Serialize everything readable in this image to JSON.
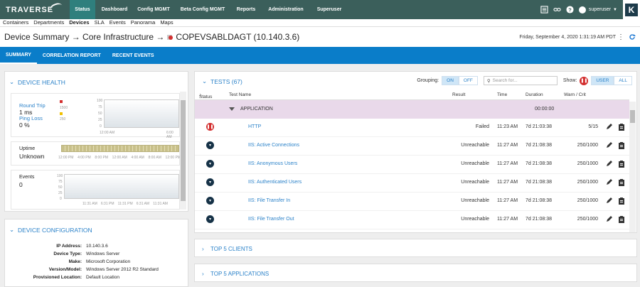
{
  "brand": {
    "logo_text": "TRAVERSE"
  },
  "topnav": [
    {
      "label": "Status",
      "active": true
    },
    {
      "label": "Dashboard"
    },
    {
      "label": "Config MGMT"
    },
    {
      "label": "Beta Config MGMT"
    },
    {
      "label": "Reports"
    },
    {
      "label": "Administration"
    },
    {
      "label": "Superuser"
    }
  ],
  "user": {
    "name": "superuser",
    "app_badge": "K"
  },
  "subnav": [
    {
      "label": "Containers"
    },
    {
      "label": "Departments"
    },
    {
      "label": "Devices",
      "active": true
    },
    {
      "label": "SLA"
    },
    {
      "label": "Events"
    },
    {
      "label": "Panorama"
    },
    {
      "label": "Maps"
    }
  ],
  "page": {
    "title_prefix": "Device Summary → Core Infrastructure →",
    "device_name": "COPEVSABLDAGT (10.140.3.6)",
    "datetime": "Friday, September 4, 2020 1:31:19 AM PDT"
  },
  "tabs": [
    {
      "label": "SUMMARY",
      "active": true
    },
    {
      "label": "CORRELATION REPORT"
    },
    {
      "label": "RECENT EVENTS"
    }
  ],
  "device_health": {
    "title": "DEVICE HEALTH",
    "round_trip_label": "Round Trip",
    "round_trip_value": "1 ms",
    "ping_loss_label": "Ping Loss",
    "ping_loss_value": "0 %",
    "legend_1500": "1500",
    "legend_250": "250",
    "rt_yticks": [
      "100",
      "75",
      "50",
      "25",
      "0"
    ],
    "rt_xticks": [
      "12:00 AM",
      "6:00 AM"
    ],
    "uptime_label": "Uptime",
    "uptime_value": "Unknown",
    "uptime_xticks": [
      "12:00 PM",
      "4:00 PM",
      "8:00 PM",
      "12:00 AM",
      "4:00 AM",
      "8:00 AM",
      "12:00 PM"
    ],
    "events_label": "Events",
    "events_value": "0",
    "ev_yticks": [
      "100",
      "75",
      "50",
      "25",
      "0"
    ],
    "ev_xticks": [
      "11:31 AM",
      "6:31 PM",
      "11:31 PM",
      "6:31 AM",
      "11:31 AM"
    ]
  },
  "device_config": {
    "title": "DEVICE CONFIGURATION",
    "rows": [
      {
        "k": "IP Address:",
        "v": "10.140.3.6"
      },
      {
        "k": "Device Type:",
        "v": "Windows Server"
      },
      {
        "k": "Make:",
        "v": "Microsoft Corporation"
      },
      {
        "k": "Version/Model:",
        "v": "Windows Server 2012 R2 Standard"
      },
      {
        "k": "Provisioned Location:",
        "v": "Default Location"
      }
    ]
  },
  "tests": {
    "title": "TESTS (67)",
    "grouping_label": "Grouping:",
    "on": "ON",
    "off": "OFF",
    "search_placeholder": "Search for...",
    "show_label": "Show:",
    "user": "USER",
    "all": "ALL",
    "columns": {
      "status": "Status",
      "name": "Test Name",
      "result": "Result",
      "time": "Time",
      "duration": "Duration",
      "warn": "Warn / Crit"
    },
    "group": {
      "name": "APPLICATION",
      "duration": "00:00:00"
    },
    "rows": [
      {
        "status": "fail",
        "name": "HTTP",
        "result": "Failed",
        "time": "11:23 AM",
        "duration": "7d 21:03:38",
        "warn": "5/15"
      },
      {
        "status": "unr",
        "name": "IIS: Active Connections",
        "result": "Unreachable",
        "time": "11:27 AM",
        "duration": "7d 21:08:38",
        "warn": "250/1000"
      },
      {
        "status": "unr",
        "name": "IIS: Anonymous Users",
        "result": "Unreachable",
        "time": "11:27 AM",
        "duration": "7d 21:08:38",
        "warn": "250/1000"
      },
      {
        "status": "unr",
        "name": "IIS: Authenticated Users",
        "result": "Unreachable",
        "time": "11:27 AM",
        "duration": "7d 21:08:38",
        "warn": "250/1000"
      },
      {
        "status": "unr",
        "name": "IIS: File Transfer In",
        "result": "Unreachable",
        "time": "11:27 AM",
        "duration": "7d 21:08:38",
        "warn": "250/1000"
      },
      {
        "status": "unr",
        "name": "IIS: File Transfer Out",
        "result": "Unreachable",
        "time": "11:27 AM",
        "duration": "7d 21:08:38",
        "warn": "250/1000"
      }
    ]
  },
  "top5_clients": {
    "title": "TOP 5 CLIENTS"
  },
  "top5_apps": {
    "title": "TOP 5 APPLICATIONS"
  }
}
